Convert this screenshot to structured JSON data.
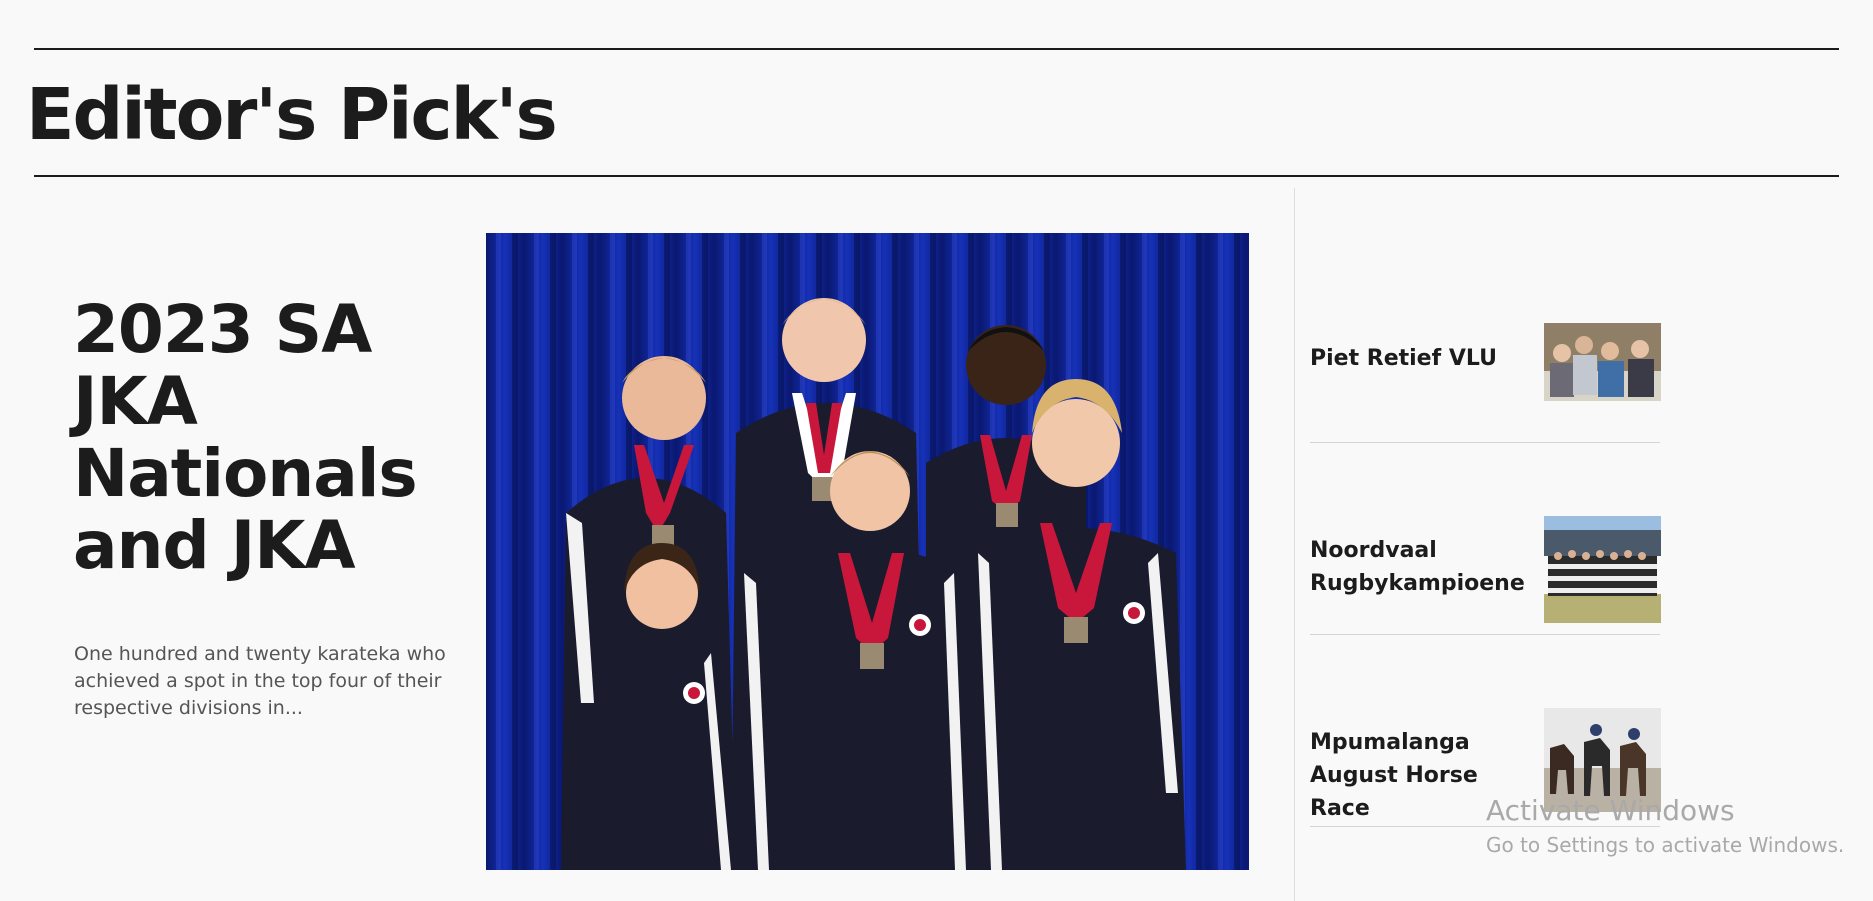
{
  "section": {
    "title": "Editor's Pick's"
  },
  "feature": {
    "title": "2023 SA JKA Nationals and JKA",
    "summary": "One hundred and twenty karateka who achieved a spot in the top four of their respective divisions in..."
  },
  "side_list": [
    {
      "title": "Piet Retief VLU"
    },
    {
      "title": "Noordvaal Rugbykampioene"
    },
    {
      "title": "Mpumalanga August Horse Race"
    }
  ],
  "watermark": {
    "title": "Activate Windows",
    "subtitle": "Go to Settings to activate Windows."
  },
  "colors": {
    "background": "#f9f9f9",
    "text": "#1c1c1c",
    "muted_text": "#555555",
    "curtain_blue": "#0d1f8a",
    "ribbon_red": "#c8173a",
    "jacket_navy": "#1a1c2e"
  }
}
